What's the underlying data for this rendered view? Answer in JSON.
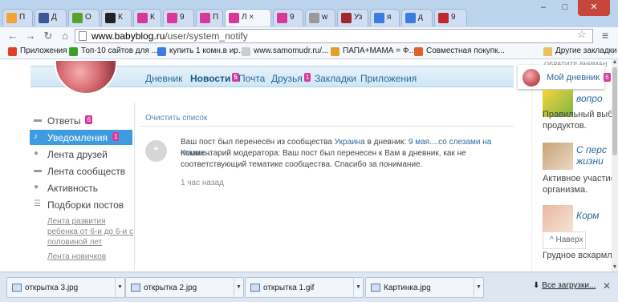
{
  "browser": {
    "tabs": [
      {
        "label": "П",
        "color": "#f2a33a"
      },
      {
        "label": "Д",
        "color": "#3b5998"
      },
      {
        "label": "О",
        "color": "#5aa02c"
      },
      {
        "label": "К",
        "color": "#222222"
      },
      {
        "label": "К",
        "color": "#d8389a"
      },
      {
        "label": "9",
        "color": "#d8389a"
      },
      {
        "label": "П",
        "color": "#d8389a"
      },
      {
        "label": "Л",
        "color": "#d8389a"
      },
      {
        "label": "9",
        "color": "#d8389a"
      },
      {
        "label": "w",
        "color": "#999999"
      },
      {
        "label": "Уз",
        "color": "#a0282e"
      },
      {
        "label": "я",
        "color": "#3c7be0"
      },
      {
        "label": "д",
        "color": "#3c7be0"
      },
      {
        "label": "9",
        "color": "#c0282e"
      }
    ],
    "window_controls": {
      "minimize": "–",
      "maximize": "□",
      "close": "✕"
    },
    "url_host": "www.babyblog.ru",
    "url_path": "/user/system_notify",
    "bookmarks": [
      {
        "label": "Приложения",
        "color": "#e0402a"
      },
      {
        "label": "Топ-10 сайтов для ...",
        "color": "#3aa02a"
      },
      {
        "label": "купить 1 комн.в ир...",
        "color": "#3c7be0"
      },
      {
        "label": "www.samomudr.ru/...",
        "color": "#cccccc"
      },
      {
        "label": "ПАПА+МАМА = Ф...",
        "color": "#e0a02a"
      },
      {
        "label": "Совместная покупк...",
        "color": "#e0602a"
      }
    ],
    "other_bookmarks": "Другие закладки"
  },
  "site": {
    "nav": [
      {
        "label": "Дневник",
        "badge": ""
      },
      {
        "label": "Новости",
        "badge": "5"
      },
      {
        "label": "Почта",
        "badge": ""
      },
      {
        "label": "Друзья",
        "badge": "1"
      },
      {
        "label": "Закладки",
        "badge": ""
      },
      {
        "label": "Приложения",
        "badge": ""
      }
    ],
    "sidebar": [
      {
        "label": "Ответы",
        "badge": "6",
        "icon": "speech-bubble-icon"
      },
      {
        "label": "Уведомления",
        "badge": "1",
        "icon": "bell-icon"
      },
      {
        "label": "Лента друзей",
        "badge": "",
        "icon": "people-icon"
      },
      {
        "label": "Лента сообществ",
        "badge": "",
        "icon": "speech-bubble-icon"
      },
      {
        "label": "Активность",
        "badge": "",
        "icon": "circle-icon"
      },
      {
        "label": "Подборки постов",
        "badge": "",
        "icon": "list-icon"
      }
    ],
    "sublinks": [
      "Лента развития ребенка от 6-и до 6-и с половиной лет",
      "Лента новичков"
    ],
    "clear_list": "Очистить список",
    "notification": {
      "text1": "Ваш пост был перенесён из сообщества ",
      "community": "Украина",
      "text2": " в дневник: ",
      "post": "9 мая....со слезами на глазах...",
      "comment": "Комментарий модератора: Ваш пост был перенесен к Вам в дневник, как не соответствующий тематике сообщества. Спасибо за понимание.",
      "time": "1 час назад"
    },
    "right": {
      "header_cut": "ОБРАТИТЕ ВНИМАН",
      "my_diary": "Мой дневник",
      "my_diary_badge": "6",
      "link1": "вопро",
      "text1a": "Правильный выбо",
      "text1b": "продуктов.",
      "link2a": "С перс",
      "link2b": "жизни",
      "text2a": "Активное участие",
      "text2b": "организма.",
      "link3": "Корм",
      "text3a": "Грудное вскармл",
      "up_button": "Наверх"
    }
  },
  "downloads": {
    "items": [
      {
        "name": "открытка 3.jpg"
      },
      {
        "name": "открытка 2.jpg"
      },
      {
        "name": "открытка 1.gif"
      },
      {
        "name": "Картинка.jpg"
      }
    ],
    "all": "Все загрузки..."
  }
}
